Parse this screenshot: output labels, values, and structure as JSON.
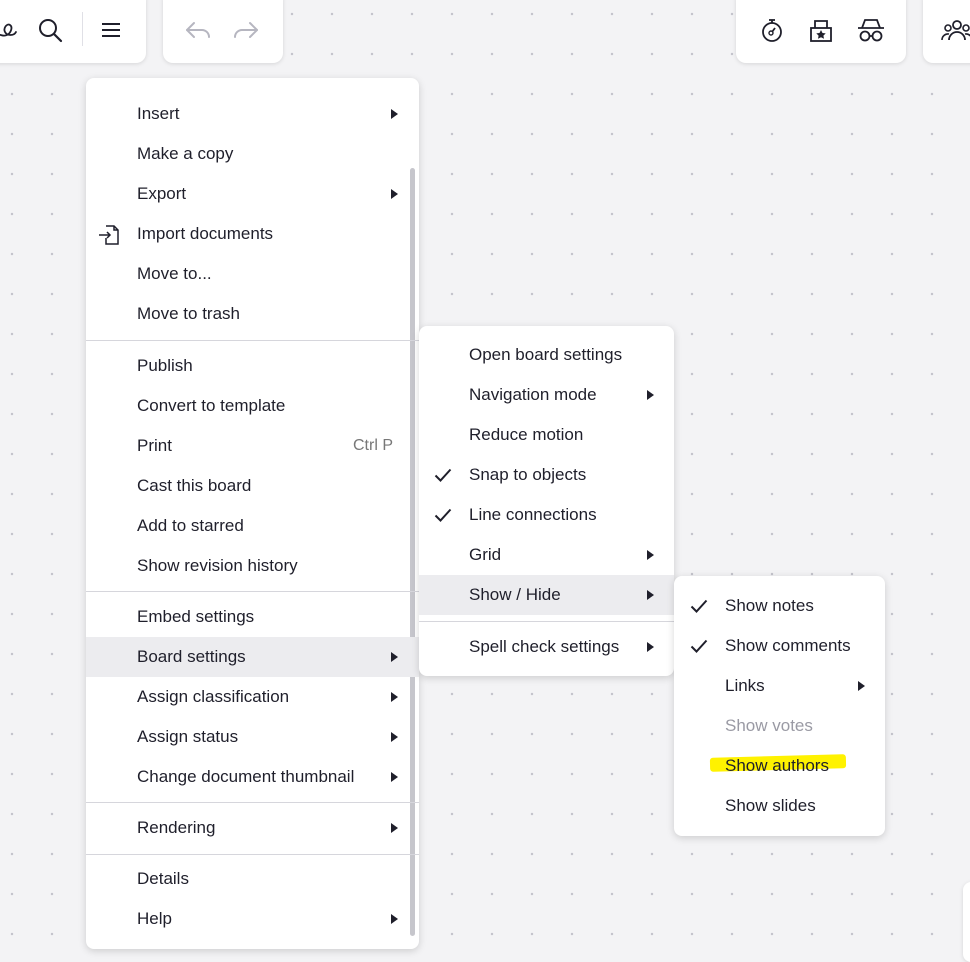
{
  "toolbar_left": {
    "icons": [
      "brush-icon",
      "search-icon",
      "menu-icon"
    ]
  },
  "toolbar_history": {
    "icons": [
      "undo-icon",
      "redo-icon"
    ]
  },
  "toolbar_right": {
    "icons": [
      "timer-icon",
      "voting-icon",
      "private-mode-icon"
    ]
  },
  "toolbar_collab": {
    "icons": [
      "users-icon"
    ]
  },
  "main_menu": {
    "group1": [
      {
        "label": "Insert",
        "submenu": true
      },
      {
        "label": "Make a copy"
      },
      {
        "label": "Export",
        "submenu": true
      },
      {
        "label": "Import documents",
        "icon": "import-icon"
      },
      {
        "label": "Move to..."
      },
      {
        "label": "Move to trash"
      }
    ],
    "group2": [
      {
        "label": "Publish"
      },
      {
        "label": "Convert to template"
      },
      {
        "label": "Print",
        "shortcut": "Ctrl P"
      },
      {
        "label": "Cast this board"
      },
      {
        "label": "Add to starred"
      },
      {
        "label": "Show revision history"
      }
    ],
    "group3": [
      {
        "label": "Embed settings"
      },
      {
        "label": "Board settings",
        "submenu": true,
        "highlighted": true
      },
      {
        "label": "Assign classification",
        "submenu": true
      },
      {
        "label": "Assign status",
        "submenu": true
      },
      {
        "label": "Change document thumbnail",
        "submenu": true
      }
    ],
    "group4": [
      {
        "label": "Rendering",
        "submenu": true
      }
    ],
    "group5": [
      {
        "label": "Details"
      },
      {
        "label": "Help",
        "submenu": true
      }
    ]
  },
  "board_settings_menu": {
    "items": [
      {
        "label": "Open board settings"
      },
      {
        "label": "Navigation mode",
        "submenu": true
      },
      {
        "label": "Reduce motion"
      },
      {
        "label": "Snap to objects",
        "checked": true
      },
      {
        "label": "Line connections",
        "checked": true
      },
      {
        "label": "Grid",
        "submenu": true
      },
      {
        "label": "Show / Hide",
        "submenu": true,
        "highlighted": true
      },
      {
        "label": "Spell check settings",
        "submenu": true
      }
    ]
  },
  "show_hide_menu": {
    "items": [
      {
        "label": "Show notes",
        "checked": true
      },
      {
        "label": "Show comments",
        "checked": true
      },
      {
        "label": "Links",
        "submenu": true
      },
      {
        "label": "Show votes",
        "disabled": true
      },
      {
        "label": "Show authors",
        "annotation": "yellow-highlight"
      },
      {
        "label": "Show slides"
      }
    ]
  },
  "colors": {
    "canvas": "#f3f3f5",
    "panel": "#ffffff",
    "text": "#1f1f2b",
    "disabled_text": "#9a9aa4",
    "hover_bg": "#ececef",
    "annotation_highlight": "#fff200"
  }
}
